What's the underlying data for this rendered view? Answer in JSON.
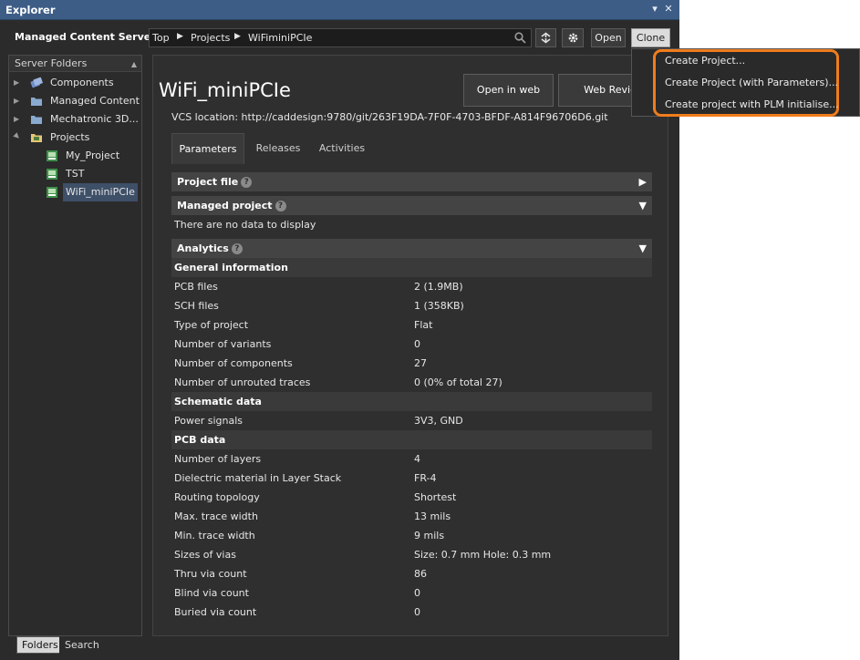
{
  "window": {
    "title": "Explorer",
    "pin_glyph": "▾",
    "close_glyph": "✕"
  },
  "toolbar": {
    "server_label": "Managed Content Server",
    "breadcrumb": [
      "Top",
      "Projects",
      "WiFiminiPCIe"
    ],
    "open_label": "Open",
    "clone_label": "Clone"
  },
  "left_panel": {
    "header": "Server Folders",
    "items": [
      {
        "label": "Components",
        "icon": "components-icon"
      },
      {
        "label": "Managed Content",
        "icon": "folder-icon"
      },
      {
        "label": "Mechatronic 3D...",
        "icon": "folder-icon"
      },
      {
        "label": "Projects",
        "icon": "projects-folder-icon"
      },
      {
        "label": "My_Project",
        "icon": "project-icon"
      },
      {
        "label": "TST",
        "icon": "project-icon"
      },
      {
        "label": "WiFi_miniPCIe",
        "icon": "project-icon"
      }
    ],
    "tabs": [
      "Folders",
      "Search"
    ]
  },
  "main": {
    "project_title": "WiFi_miniPCIe",
    "open_in_web_label": "Open in web",
    "web_review_label": "Web Review",
    "vcs_location": "VCS location: http://caddesign:9780/git/263F19DA-7F0F-4703-BFDF-A814F96706D6.git",
    "tabs": [
      "Parameters",
      "Releases",
      "Activities"
    ],
    "sections": {
      "project_file": "Project file",
      "managed_project": "Managed project",
      "no_data": "There are no data to display",
      "analytics": "Analytics"
    },
    "general": {
      "title": "General information",
      "rows": [
        {
          "k": "PCB files",
          "v": "2 (1.9MB)"
        },
        {
          "k": "SCH files",
          "v": "1 (358KB)"
        },
        {
          "k": "Type of project",
          "v": "Flat"
        },
        {
          "k": "Number of variants",
          "v": "0"
        },
        {
          "k": "Number of components",
          "v": "27"
        },
        {
          "k": "Number of unrouted traces",
          "v": "0 (0% of total 27)"
        }
      ]
    },
    "schematic": {
      "title": "Schematic data",
      "rows": [
        {
          "k": "Power signals",
          "v": "3V3, GND"
        }
      ]
    },
    "pcb": {
      "title": "PCB data",
      "rows": [
        {
          "k": "Number of layers",
          "v": "4"
        },
        {
          "k": "Dielectric material in Layer Stack",
          "v": "FR-4"
        },
        {
          "k": "Routing topology",
          "v": "Shortest"
        },
        {
          "k": "Max. trace width",
          "v": "13 mils"
        },
        {
          "k": "Min. trace width",
          "v": "9 mils"
        },
        {
          "k": "Sizes of vias",
          "v": "Size: 0.7 mm Hole: 0.3 mm"
        },
        {
          "k": "Thru via count",
          "v": "86"
        },
        {
          "k": "Blind via count",
          "v": "0"
        },
        {
          "k": "Buried via count",
          "v": "0"
        }
      ]
    }
  },
  "dropdown": {
    "items": [
      "Create Project...",
      "Create Project (with Parameters)...",
      "Create project with PLM initialise..."
    ],
    "highlight_color": "#f07d1c"
  }
}
